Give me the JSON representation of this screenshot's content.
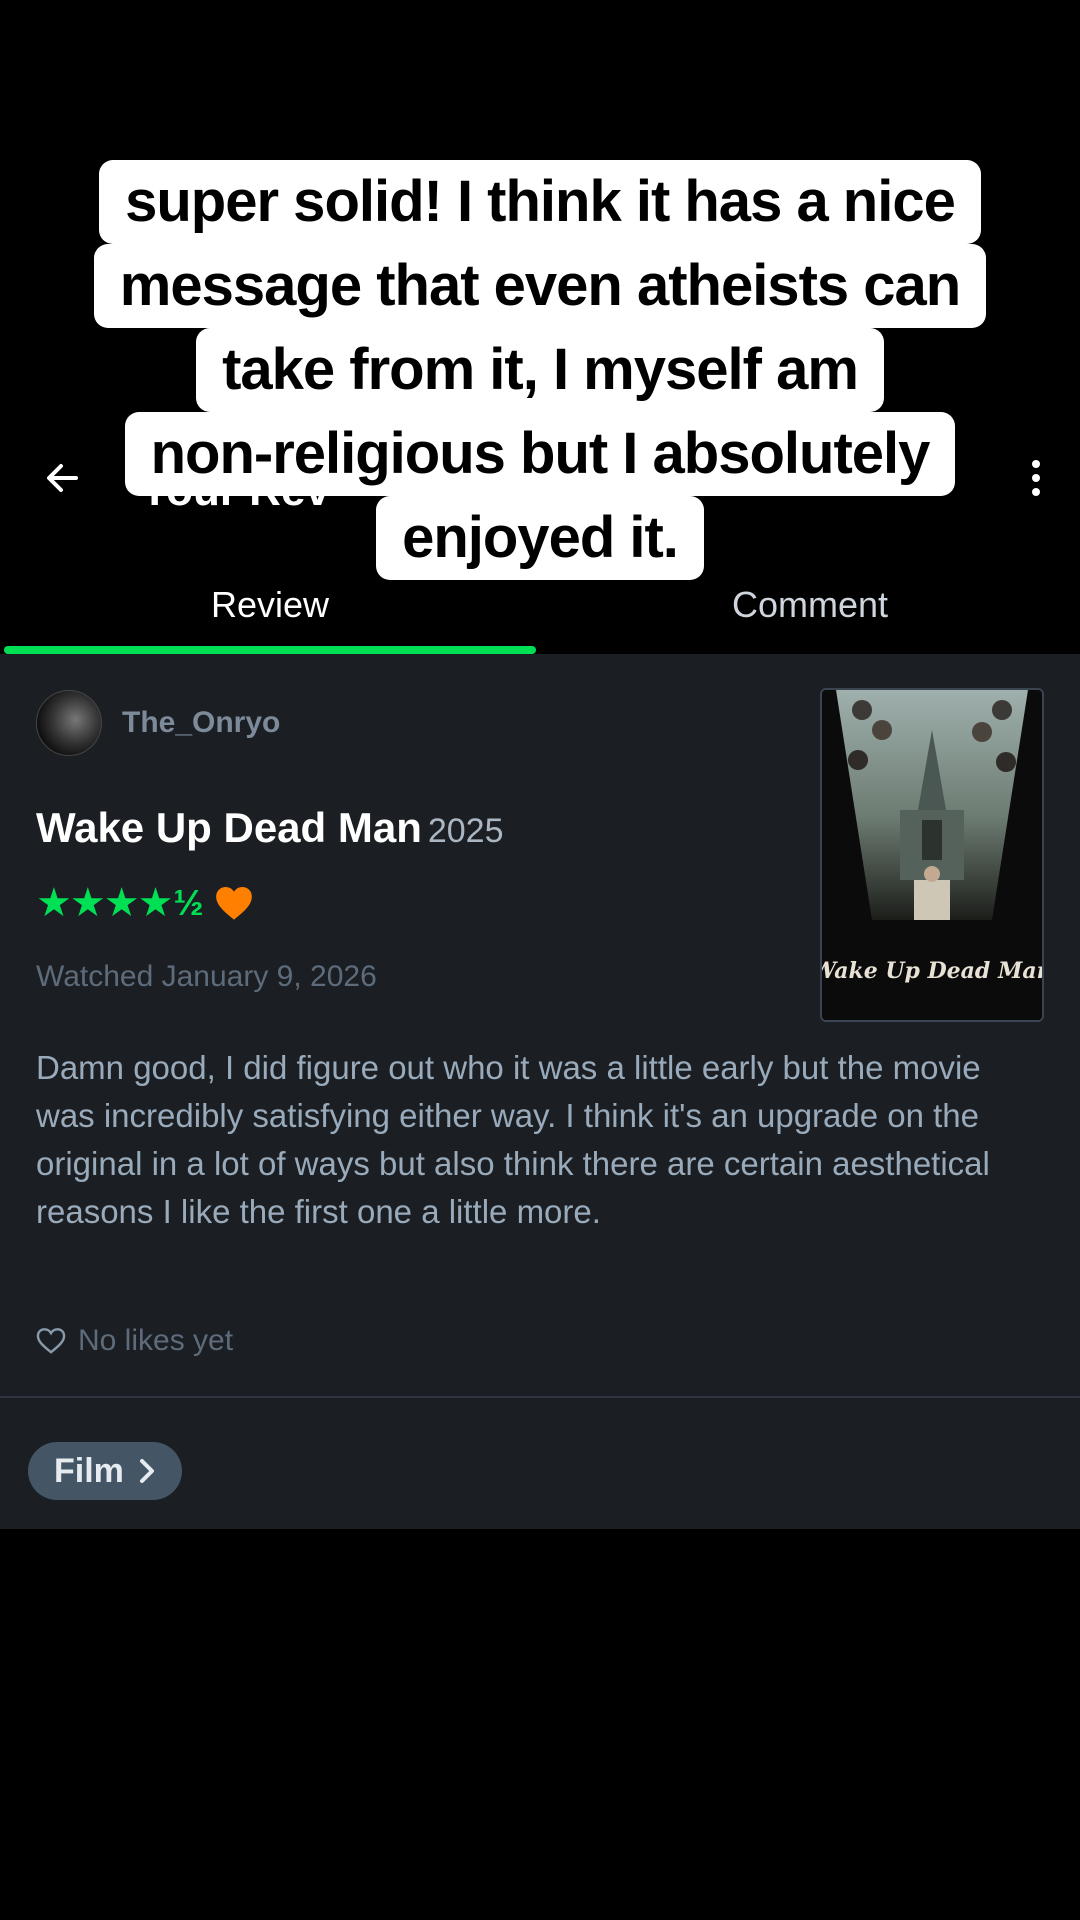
{
  "app_bar": {
    "title": "Your Rev",
    "back_icon": "arrow-left-icon",
    "more_icon": "more-vertical-icon"
  },
  "caption": {
    "lines": [
      "super solid! I think it has a nice",
      "message that even atheists can",
      "take from it, I myself am",
      "non-religious but I absolutely",
      "enjoyed it."
    ]
  },
  "tabs": [
    {
      "label": "Review",
      "active": true
    },
    {
      "label": "Comment",
      "active": false
    }
  ],
  "review": {
    "username": "The_Onryo",
    "movie_title": "Wake Up Dead Man",
    "year": "2025",
    "stars_full": "★★★★",
    "stars_half": "½",
    "rating_value": 4.5,
    "liked": true,
    "watched": "Watched January 9, 2026",
    "poster_title": "Wake Up Dead Man",
    "body": "Damn good, I did figure out who it was a little early but the movie was incredibly satisfying either way. I think it's an upgrade on the original in a lot of ways but also think there are certain aesthetical reasons I like the first one a little more.",
    "likes_label": "No likes yet"
  },
  "footer": {
    "film_button": "Film"
  },
  "colors": {
    "accent_green": "#00e054",
    "heart_orange": "#ff8000",
    "panel_bg": "#1b1f24",
    "chip_bg": "#445566"
  }
}
